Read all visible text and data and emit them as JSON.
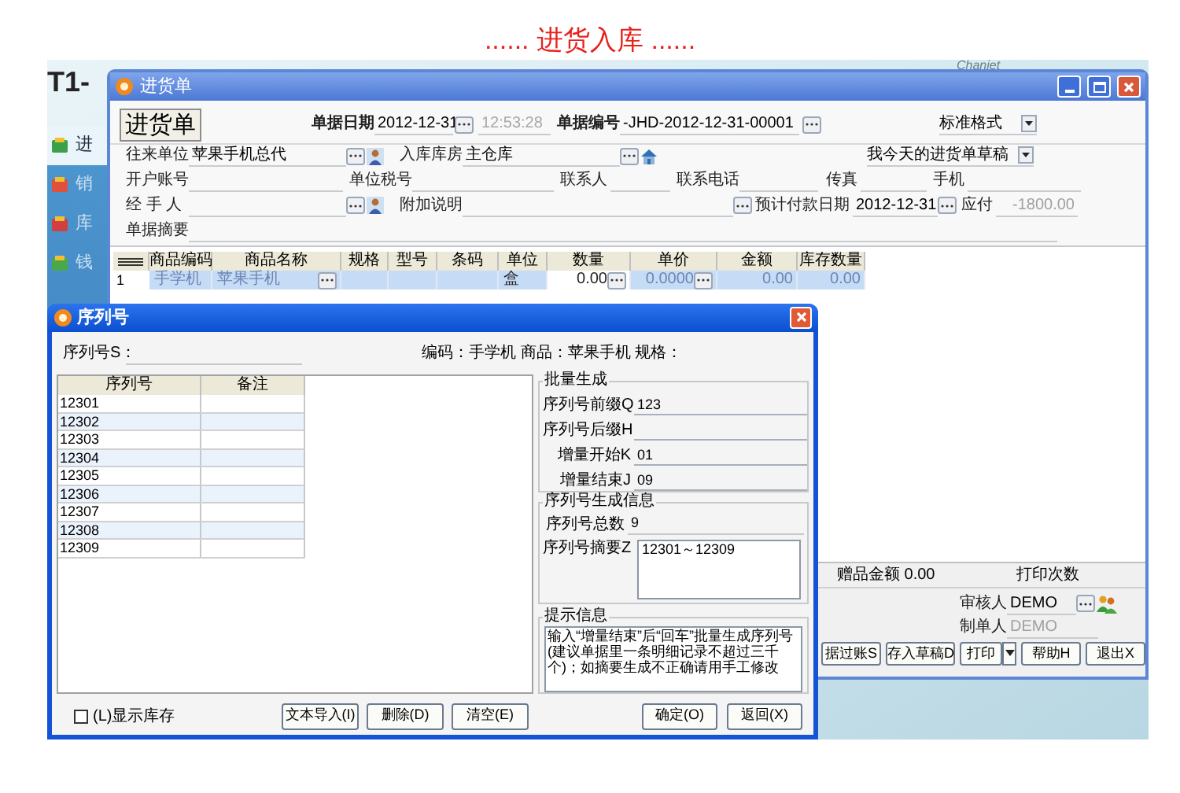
{
  "page_title": "...... 进货入库 ......",
  "background_app": {
    "logo": "T1-",
    "corner_text": "Chaniet",
    "sidebar": [
      {
        "label": "进",
        "selected": true
      },
      {
        "label": "销",
        "selected": false
      },
      {
        "label": "库",
        "selected": false
      },
      {
        "label": "钱",
        "selected": false
      }
    ]
  },
  "purchase_window": {
    "title": "进货单",
    "heading": "进货单",
    "doc_date_label": "单据日期",
    "doc_date": "2012-12-31",
    "doc_time": "12:53:28",
    "doc_no_label": "单据编号",
    "doc_no": "-JHD-2012-12-31-00001",
    "format": "标准格式",
    "partner_label": "往来单位",
    "partner": "苹果手机总代",
    "warehouse_label": "入库库房",
    "warehouse": "主仓库",
    "draft": "我今天的进货单草稿",
    "account_label": "开户账号",
    "tax_no_label": "单位税号",
    "contact_label": "联系人",
    "phone_label": "联系电话",
    "fax_label": "传真",
    "mobile_label": "手机",
    "handler_label": "经 手 人",
    "note_label": "附加说明",
    "pay_date_label": "预计付款日期",
    "pay_date": "2012-12-31",
    "payable_label": "应付",
    "payable": "-1800.00",
    "summary_label": "单据摘要",
    "table": {
      "columns": [
        "商品编码",
        "商品名称",
        "规格",
        "型号",
        "条码",
        "单位",
        "数量",
        "单价",
        "金额",
        "库存数量"
      ],
      "rows": [
        {
          "no": "1",
          "code": "手学机",
          "name": "苹果手机",
          "unit": "盒",
          "qty": "0.00",
          "price": "0.0000",
          "amount": "0.00",
          "stock": "0.00",
          "selected": true
        }
      ]
    },
    "gift_amount": "赠品金额 0.00",
    "print_count_label": "打印次数",
    "reviewer_label": "审核人",
    "reviewer": "DEMO",
    "maker_label": "制单人",
    "maker": "DEMO",
    "buttons": [
      "据过账S",
      "存入草稿D",
      "打印",
      "帮助H",
      "退出X"
    ]
  },
  "serial_dialog": {
    "title": "序列号",
    "serial_label": "序列号S：",
    "product_info": "编码：手学机 商品：苹果手机 规格：",
    "grid": {
      "columns": [
        "序列号",
        "备注"
      ],
      "rows": [
        "12301",
        "12302",
        "12303",
        "12304",
        "12305",
        "12306",
        "12307",
        "12308",
        "12309"
      ]
    },
    "batch": {
      "title": "批量生成",
      "fields": [
        {
          "label": "序列号前缀Q",
          "value": "123"
        },
        {
          "label": "序列号后缀H"
        },
        {
          "label": "增量开始K",
          "value": "01"
        },
        {
          "label": "增量结束J",
          "value": "09"
        }
      ]
    },
    "info": {
      "title": "序列号生成信息",
      "total_label": "序列号总数",
      "total": "9",
      "summary_label": "序列号摘要Z",
      "summary": "12301～12309"
    },
    "hint": {
      "title": "提示信息",
      "text": "输入“增量结束”后“回车”批量生成序列号(建议单据里一条明细记录不超过三千个)；如摘要生成不正确请用手工修改"
    },
    "show_stock": {
      "label": "(L)显示库存",
      "checked": false
    },
    "buttons": [
      "文本导入(I)",
      "删除(D)",
      "清空(E)"
    ],
    "dialog_buttons": [
      "确定(O)",
      "返回(X)"
    ]
  }
}
